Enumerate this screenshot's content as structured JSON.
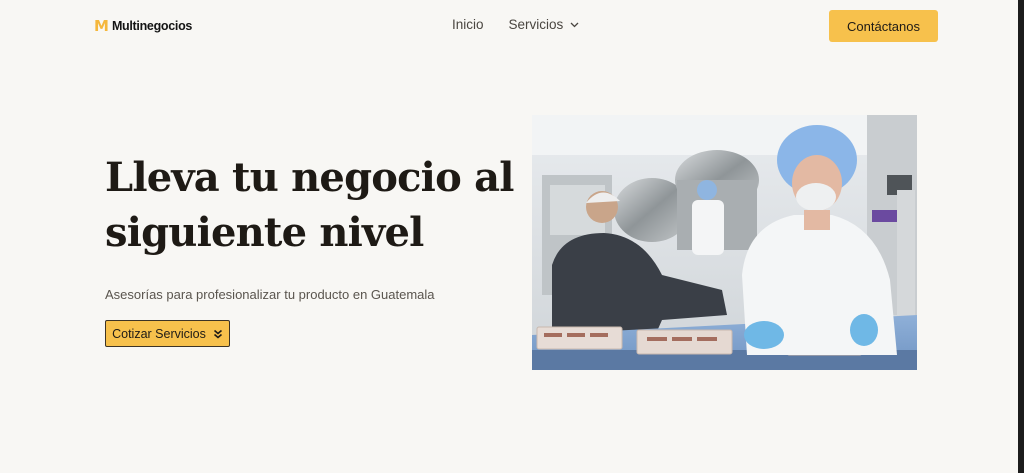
{
  "header": {
    "logo_mark": "M",
    "logo_text": "Multinegocios",
    "nav": [
      {
        "label": "Inicio"
      },
      {
        "label": "Servicios",
        "has_dropdown": true
      }
    ],
    "cta_label": "Contáctanos"
  },
  "hero": {
    "title_line1": "Lleva tu negocio al",
    "title_line2": "siguiente nivel",
    "subtitle": "Asesorías para profesionalizar tu producto en Guatemala",
    "button_label": "Cotizar Servicios",
    "image_description_icon": "factory-workers-photo"
  },
  "colors": {
    "background": "#f8f7f4",
    "accent": "#f7c14c",
    "logo": "#f5b73c",
    "text": "#1e1a15"
  }
}
